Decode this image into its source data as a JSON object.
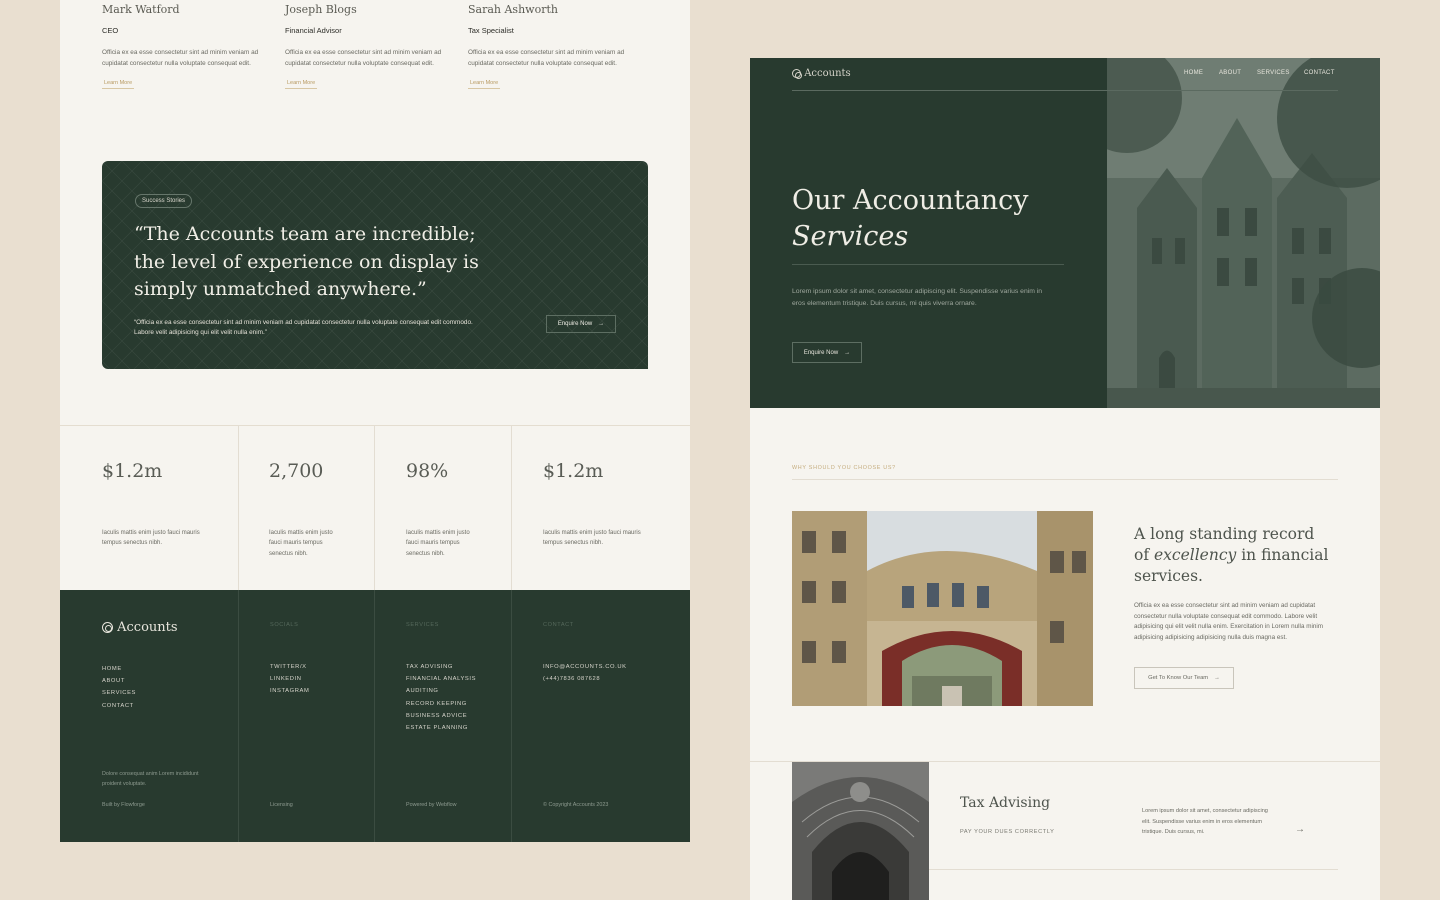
{
  "left_page": {
    "team": [
      {
        "name": "Mark Watford",
        "role": "CEO",
        "desc": "Officia ex ea esse consectetur sint ad minim veniam ad cupidatat consectetur nulla voluptate consequat edit.",
        "link": "Learn More"
      },
      {
        "name": "Joseph Blogs",
        "role": "Financial Advisor",
        "desc": "Officia ex ea esse consectetur sint ad minim veniam ad cupidatat consectetur nulla voluptate consequat edit.",
        "link": "Learn More"
      },
      {
        "name": "Sarah Ashworth",
        "role": "Tax Specialist",
        "desc": "Officia ex ea esse consectetur sint ad minim veniam ad cupidatat consectetur nulla voluptate consequat edit.",
        "link": "Learn More"
      }
    ],
    "testimonial": {
      "badge": "Success Stories",
      "quote": "“The Accounts team are incredible; the level of experience on display is simply unmatched anywhere.”",
      "body": "“Officia ex ea esse consectetur sint ad minim veniam ad cupidatat consectetur nulla voluptate consequat edit commodo. Labore velit adipisicing qui elit velit nulla enim.”",
      "button": "Enquire Now"
    },
    "stats": [
      {
        "value": "$1.2m",
        "desc": "Iaculis mattis enim justo fauci mauris tempus senectus nibh."
      },
      {
        "value": "2,700",
        "desc": "Iaculis mattis enim justo fauci mauris tempus senectus nibh."
      },
      {
        "value": "98%",
        "desc": "Iaculis mattis enim justo fauci mauris tempus senectus nibh."
      },
      {
        "value": "$1.2m",
        "desc": "Iaculis mattis enim justo fauci mauris tempus senectus nibh."
      }
    ],
    "footer": {
      "brand": "Accounts",
      "nav": [
        "HOME",
        "ABOUT",
        "SERVICES",
        "CONTACT"
      ],
      "tagline": "Dolore consequat anim Lorem incididunt proident voluptate.",
      "built": "Built by Flowforge",
      "socials_head": "SOCIALS",
      "socials": [
        "TWITTER/X",
        "LINKEDIN",
        "INSTAGRAM"
      ],
      "licensing": "Licensing",
      "services_head": "SERVICES",
      "services": [
        "TAX ADVISING",
        "FINANCIAL ANALYSIS",
        "AUDITING",
        "RECORD KEEPING",
        "BUSINESS ADVICE",
        "ESTATE PLANNING"
      ],
      "powered": "Powered by Webflow",
      "contact_head": "CONTACT",
      "contact": [
        "INFO@ACCOUNTS.CO.UK",
        "(+44)7836 087628"
      ],
      "copyright": "© Copyright Accounts 2023"
    }
  },
  "right_page": {
    "brand": "Accounts",
    "nav": [
      "HOME",
      "ABOUT",
      "SERVICES",
      "CONTACT"
    ],
    "hero_title_1": "Our Accountancy",
    "hero_title_2": "Services",
    "hero_desc": "Lorem ipsum dolor sit amet, consectetur adipiscing elit. Suspendisse varius enim in eros elementum tristique. Duis cursus, mi quis viverra ornare.",
    "hero_button": "Enquire Now",
    "why_label": "WHY SHOULD YOU CHOOSE US?",
    "section_title_a": "A long standing record of ",
    "section_title_em": "excellency",
    "section_title_b": " in financial services.",
    "section_desc": "Officia ex ea esse consectetur sint ad minim veniam ad cupidatat consectetur nulla voluptate consequat edit commodo. Labore velit adipisicing qui elit velit nulla enim. Exercitation in Lorem nulla minim adipisicing adipisicing adipisicing nulla duis magna est.",
    "team_button": "Get To Know Our Team",
    "service": {
      "title": "Tax Advising",
      "subtitle": "PAY YOUR DUES CORRECTLY",
      "desc": "Lorem ipsum dolor sit amet, consectetur adipiscing elit. Suspendisse varius enim in eros elementum tristique. Duis cursus, mi."
    }
  },
  "colors": {
    "bg": "#e9dfd0",
    "panel": "#f6f4ef",
    "green": "#283a2f",
    "gold": "#c5ad7f"
  }
}
